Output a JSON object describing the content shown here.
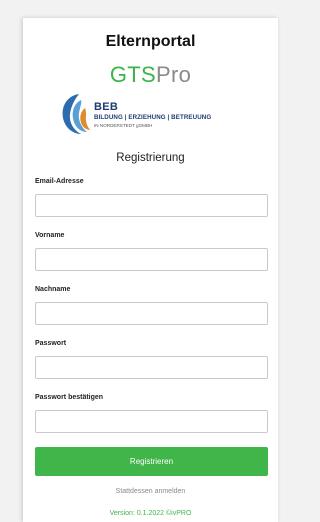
{
  "portal_title": "Elternportal",
  "gts_logo": {
    "gts": "GTS",
    "pro": "Pro"
  },
  "beb_logo": {
    "name": "BEB",
    "tagline": "BILDUNG | ERZIEHUNG | BETREUUNG",
    "sub": "IN NORDERSTEDT gGMBH"
  },
  "form": {
    "heading": "Registrierung",
    "fields": [
      {
        "label": "Email-Adresse",
        "value": "",
        "type": "email"
      },
      {
        "label": "Vorname",
        "value": "",
        "type": "text"
      },
      {
        "label": "Nachname",
        "value": "",
        "type": "text"
      },
      {
        "label": "Passwort",
        "value": "",
        "type": "password"
      },
      {
        "label": "Passwort bestätigen",
        "value": "",
        "type": "password"
      }
    ],
    "submit_label": "Registrieren",
    "login_link": "Stattdessen anmelden"
  },
  "footer": {
    "version": "Version: 0.1.2022 ©ivPRO"
  },
  "colors": {
    "accent_green": "#3fb54a",
    "brand_blue": "#1f3b73",
    "muted_gray": "#8a8a8a"
  }
}
